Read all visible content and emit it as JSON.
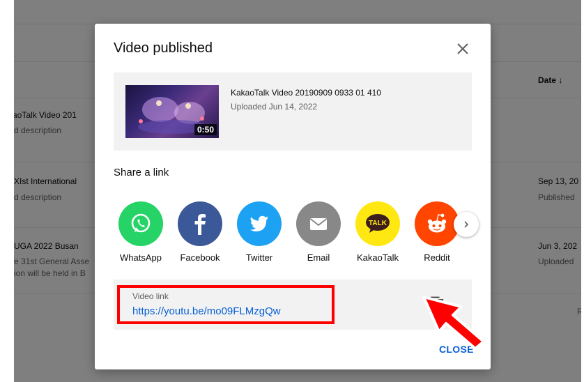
{
  "background": {
    "column_header_date": "Date",
    "rows": [
      {
        "title": "aoTalk Video 201",
        "sub": "d description",
        "date": "",
        "status": ""
      },
      {
        "title": "XIst International",
        "sub": "d description",
        "date": "Sep 13, 20",
        "status": "Published"
      },
      {
        "title": "UGA 2022 Busan",
        "sub": "e 31st General Asse",
        "sub2": "ion will be held in B",
        "date": "Jun 3, 202",
        "status": "Uploaded"
      }
    ],
    "right_fragment": "R"
  },
  "dialog": {
    "title": "Video published",
    "video": {
      "title": "KakaoTalk Video 20190909 0933 01 410",
      "uploaded": "Uploaded Jun 14, 2022",
      "duration": "0:50"
    },
    "share_label": "Share a link",
    "share_targets": [
      {
        "name": "WhatsApp",
        "color": "#25d366",
        "icon": "whatsapp-icon"
      },
      {
        "name": "Facebook",
        "color": "#3b5998",
        "icon": "facebook-icon"
      },
      {
        "name": "Twitter",
        "color": "#1da1f2",
        "icon": "twitter-icon"
      },
      {
        "name": "Email",
        "color": "#888888",
        "icon": "email-icon"
      },
      {
        "name": "KakaoTalk",
        "color": "#ffe812",
        "icon": "kakaotalk-icon"
      },
      {
        "name": "Reddit",
        "color": "#ff4500",
        "icon": "reddit-icon"
      }
    ],
    "link_label": "Video link",
    "link_url": "https://youtu.be/mo09FLMzgQw",
    "close_label": "CLOSE"
  },
  "annotations": {
    "highlight_color": "#ff0000",
    "arrow_color": "#ff0000"
  }
}
